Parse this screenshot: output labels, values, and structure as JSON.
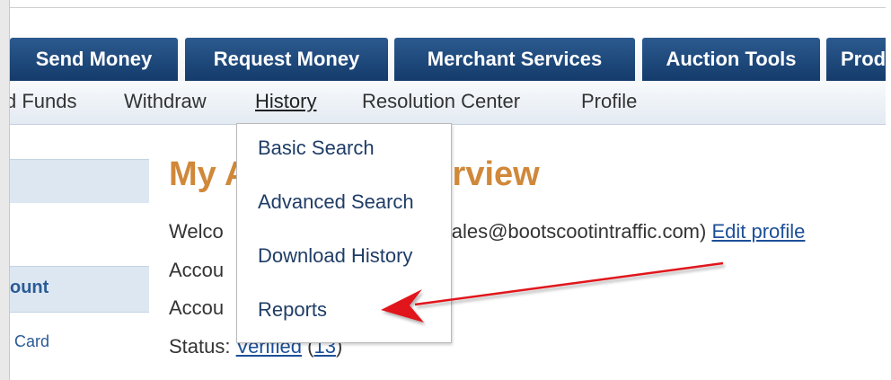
{
  "nav": {
    "tabs": [
      {
        "label": "Send Money"
      },
      {
        "label": "Request Money"
      },
      {
        "label": "Merchant Services"
      },
      {
        "label": "Auction Tools"
      },
      {
        "label": "Produ"
      }
    ]
  },
  "subnav": {
    "items": [
      {
        "label": "d Funds"
      },
      {
        "label": "Withdraw"
      },
      {
        "label": "History"
      },
      {
        "label": "Resolution Center"
      },
      {
        "label": "Profile"
      }
    ]
  },
  "sidebar": {
    "account_label": "ount",
    "card_label": "Card"
  },
  "main": {
    "title_start": "My A",
    "title_end": "erview",
    "welcome_start": "Welco",
    "welcome_end": "sales@bootscootintraffic.com)",
    "edit_profile": "Edit profile",
    "account_line1": "Accou",
    "account_line2": "Accou",
    "status_label": "Status:",
    "status_value": "Verified",
    "status_count": "13"
  },
  "history_menu": {
    "items": [
      {
        "label": "Basic Search"
      },
      {
        "label": "Advanced Search"
      },
      {
        "label": "Download History"
      },
      {
        "label": "Reports"
      }
    ]
  },
  "colors": {
    "tab_blue": "#1c4573",
    "title_orange": "#d0883a",
    "link_blue": "#1c4f99",
    "arrow_red": "#e0191c"
  }
}
